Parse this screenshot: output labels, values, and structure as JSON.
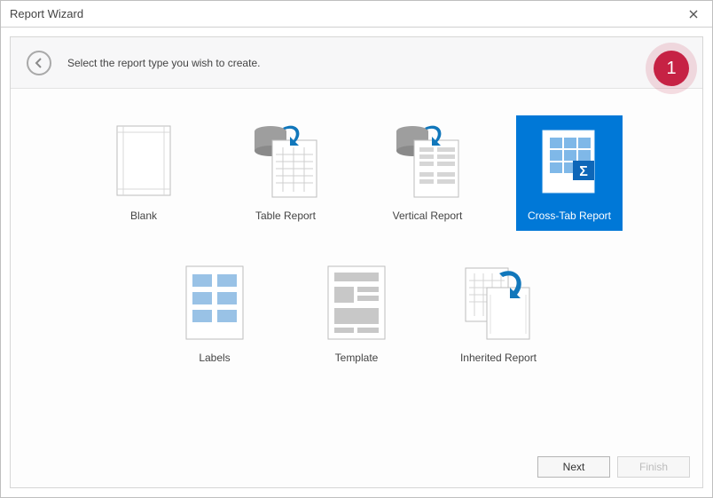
{
  "window": {
    "title": "Report Wizard"
  },
  "header": {
    "subtitle": "Select the report type you wish to create.",
    "annotation_number": "1"
  },
  "tiles": [
    {
      "id": "blank",
      "label": "Blank",
      "selected": false
    },
    {
      "id": "table",
      "label": "Table Report",
      "selected": false
    },
    {
      "id": "vertical",
      "label": "Vertical Report",
      "selected": false
    },
    {
      "id": "crosstab",
      "label": "Cross-Tab Report",
      "selected": true
    },
    {
      "id": "labels",
      "label": "Labels",
      "selected": false
    },
    {
      "id": "template",
      "label": "Template",
      "selected": false
    },
    {
      "id": "inherited",
      "label": "Inherited Report",
      "selected": false
    }
  ],
  "footer": {
    "next": "Next",
    "finish": "Finish"
  }
}
